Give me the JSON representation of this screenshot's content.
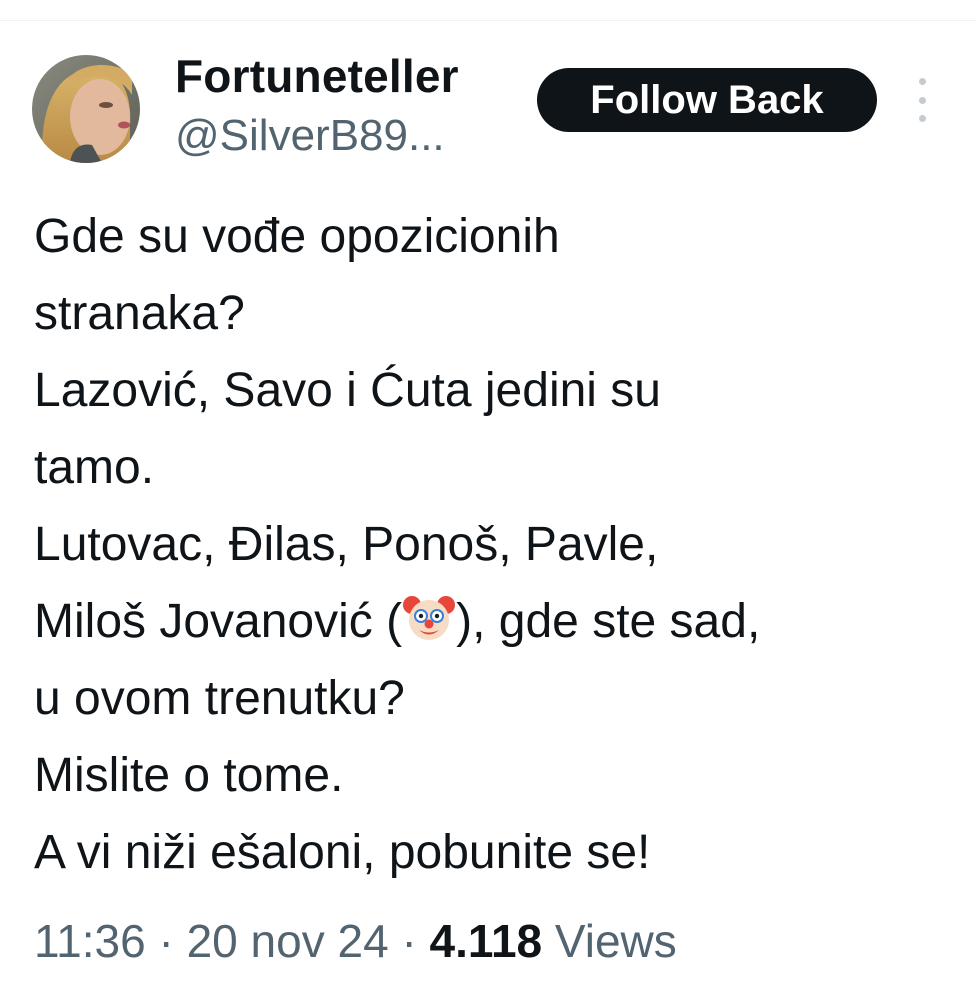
{
  "tweet": {
    "display_name": "Fortuneteller",
    "handle": "@SilverB89...",
    "follow_button": "Follow Back",
    "more_icon": "more-vertical-icon",
    "lines": {
      "l1": "Gde su vođe opozicionih",
      "l2": "stranaka?",
      "l3": "Lazović, Savo i Ćuta jedini su",
      "l4": "tamo.",
      "l5": "Lutovac, Đilas, Ponoš, Pavle,",
      "l6a": "Miloš Jovanović (",
      "l6b": "), gde ste sad,",
      "l7": "u ovom trenutku?",
      "l8": "Mislite o tome.",
      "l9": "A vi niži ešaloni, pobunite se!"
    },
    "emoji": "clown-face-icon",
    "meta": {
      "time": "11:36",
      "separator": "·",
      "date": "20 nov 24",
      "views_count": "4.118",
      "views_label": "Views"
    }
  },
  "colors": {
    "text": "#0f1419",
    "secondary": "#536471",
    "button_bg": "#0f1419",
    "button_text": "#ffffff"
  }
}
